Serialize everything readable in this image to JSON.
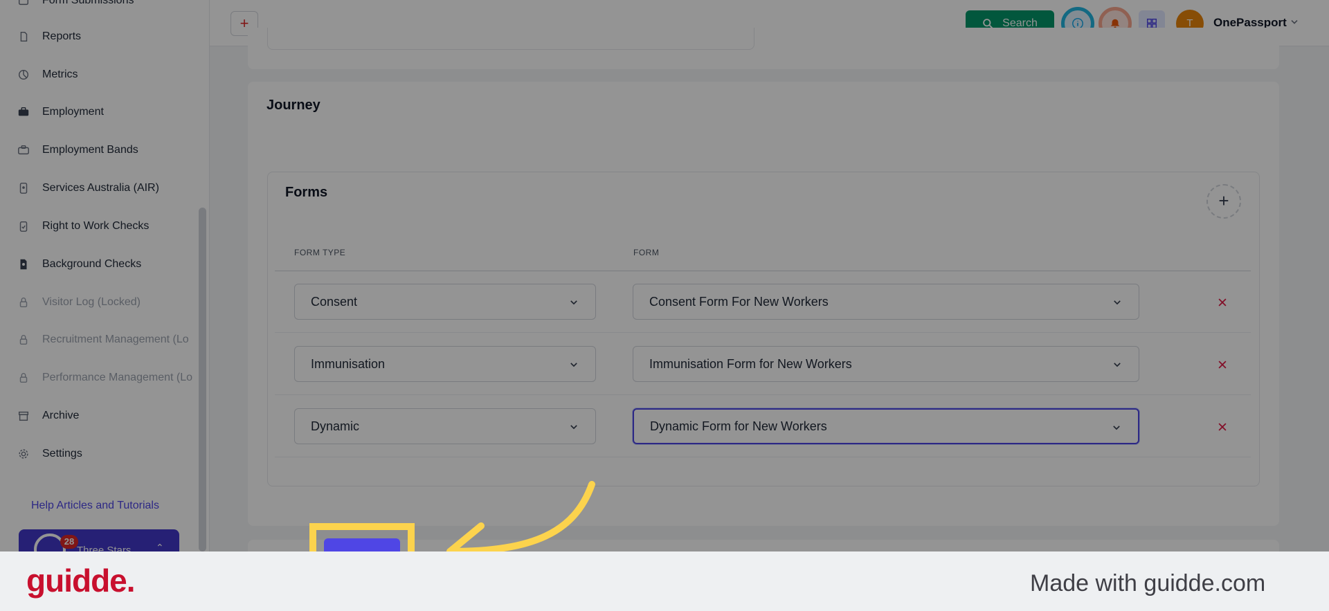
{
  "sidebar": {
    "items": [
      {
        "label": "Form Submissions",
        "icon": "inbox-icon",
        "locked": false
      },
      {
        "label": "Reports",
        "icon": "document-icon",
        "locked": false
      },
      {
        "label": "Metrics",
        "icon": "pie-chart-icon",
        "locked": false
      },
      {
        "label": "Employment",
        "icon": "briefcase-icon",
        "locked": false
      },
      {
        "label": "Employment Bands",
        "icon": "briefcase-outline-icon",
        "locked": false
      },
      {
        "label": "Services Australia (AIR)",
        "icon": "id-card-icon",
        "locked": false
      },
      {
        "label": "Right to Work Checks",
        "icon": "clipboard-check-icon",
        "locked": false
      },
      {
        "label": "Background Checks",
        "icon": "document-search-icon",
        "locked": false
      },
      {
        "label": "Visitor Log (Locked)",
        "icon": "lock-icon",
        "locked": true
      },
      {
        "label": "Recruitment Management (Lo",
        "icon": "lock-icon",
        "locked": true
      },
      {
        "label": "Performance Management (Lo",
        "icon": "lock-icon",
        "locked": true
      },
      {
        "label": "Archive",
        "icon": "archive-icon",
        "locked": false
      },
      {
        "label": "Settings",
        "icon": "gear-icon",
        "locked": false
      }
    ],
    "help_link": "Help Articles and Tutorials",
    "org": {
      "name": "Three Stars",
      "badge": "28"
    }
  },
  "topbar": {
    "search_label": "Search",
    "user_initial": "T",
    "user_name": "OnePassport"
  },
  "journey": {
    "title": "Journey",
    "forms": {
      "title": "Forms",
      "columns": {
        "type": "FORM TYPE",
        "form": "FORM"
      },
      "rows": [
        {
          "type": "Consent",
          "form": "Consent Form For New Workers"
        },
        {
          "type": "Immunisation",
          "form": "Immunisation Form for New Workers"
        },
        {
          "type": "Dynamic",
          "form": "Dynamic Form for New Workers"
        }
      ]
    }
  },
  "footer": {
    "logo": "guidde.",
    "made_with": "Made with guidde.com"
  },
  "colors": {
    "accent": "#4f46e5",
    "search": "#059669",
    "remove": "#e11d48",
    "highlight": "#fcd34d",
    "brand": "#c8102e"
  }
}
